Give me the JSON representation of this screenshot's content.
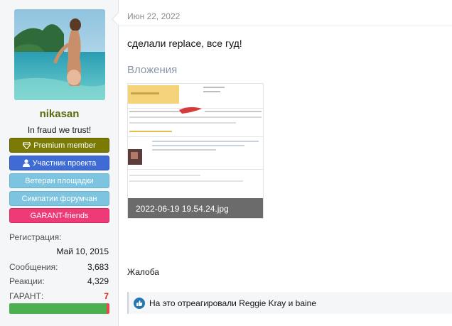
{
  "user": {
    "name": "nikasan",
    "title": "In fraud we trust!",
    "banners": {
      "premium": "Premium member",
      "member": "Участник проекта",
      "veteran": "Ветеран площадки",
      "likes": "Симпатии форумчан",
      "garant": "GARANT-friends"
    },
    "stats": {
      "registration_label": "Регистрация:",
      "registration_value": "Май 10, 2015",
      "messages_label": "Сообщения:",
      "messages_value": "3,683",
      "reactions_label": "Реакции:",
      "reactions_value": "4,329",
      "garant_label": "ГАРАНТ:",
      "garant_value": "7",
      "garant_level": 0.97
    }
  },
  "post": {
    "date": "Июн 22, 2022",
    "text": "сделали replace, все гуд!",
    "attachments_heading": "Вложения",
    "attachment_filename": "2022-06-19 19.54.24.jpg",
    "report_label": "Жалоба",
    "reactions": {
      "prefix": "На это отреагировали",
      "user1": "Reggie Kray",
      "conj": "и",
      "user2": "baine"
    }
  },
  "colors": {
    "username": "#5a6a0c",
    "premium": "#7a7a05",
    "member": "#3e6bd4",
    "veteran": "#7cc4df",
    "garant_friends": "#ee3a77",
    "garant_bar": "#4caf50",
    "garant_value": "#e0201b",
    "like_icon": "#2577b1"
  },
  "icons": {
    "premium": "diamond-icon",
    "member": "user-icon",
    "reaction": "like-icon"
  }
}
